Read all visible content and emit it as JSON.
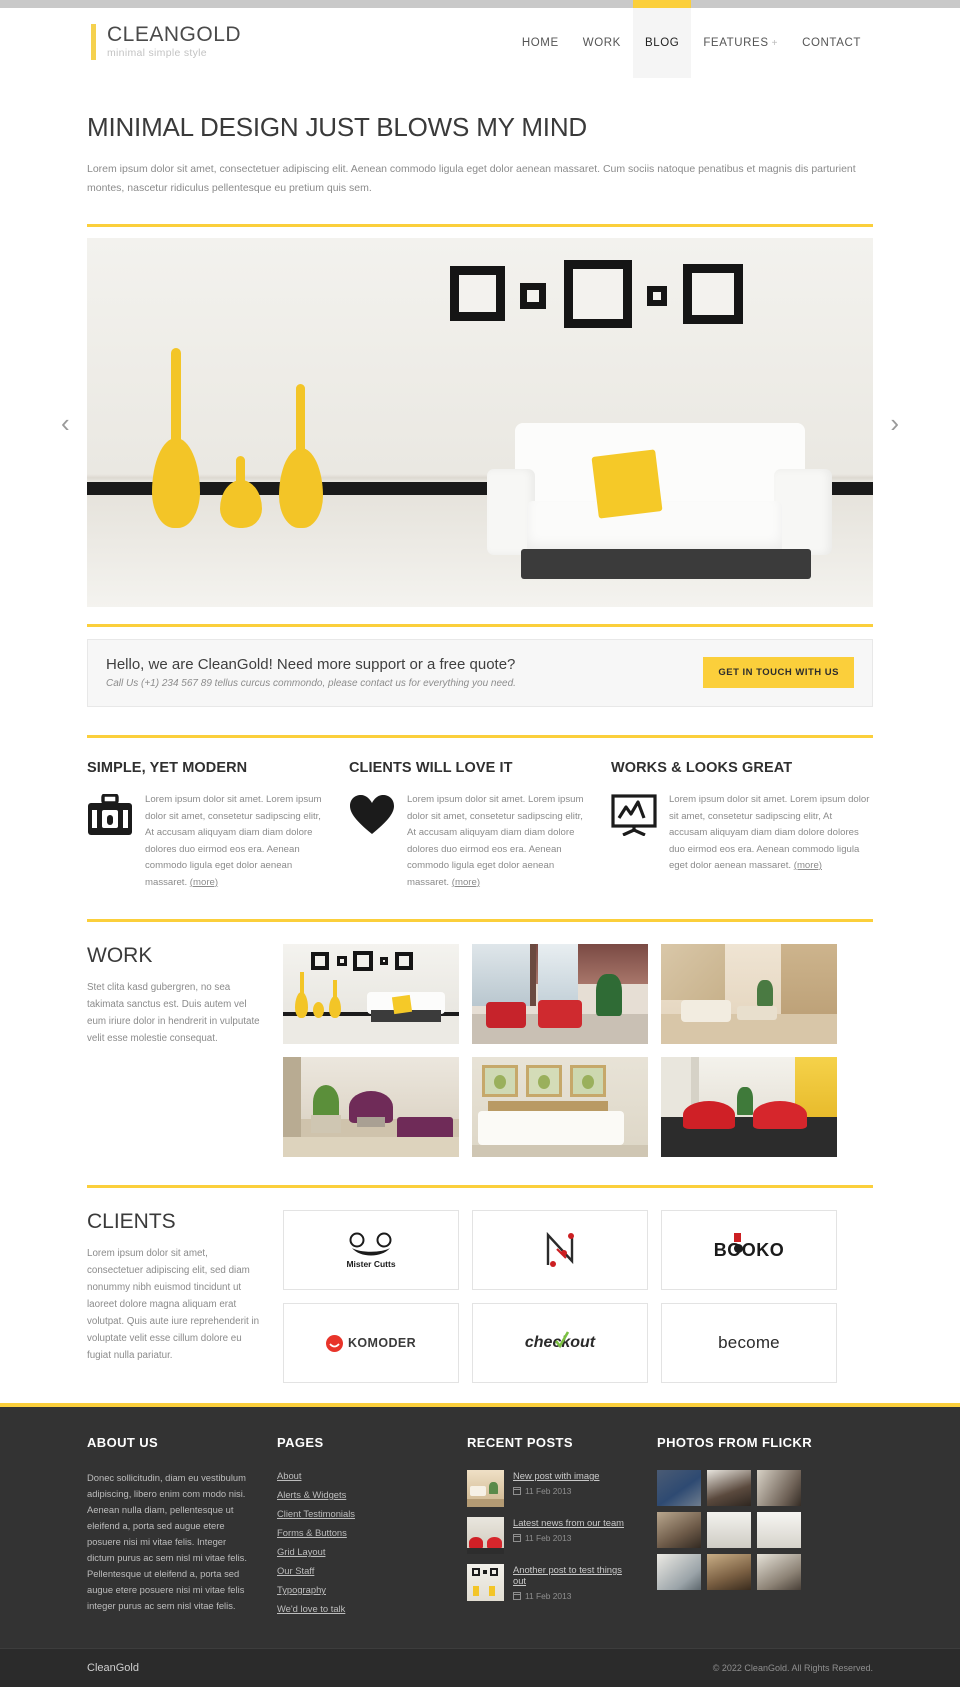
{
  "brand": {
    "name": "CLEANGOLD",
    "tagline": "minimal simple style"
  },
  "nav": {
    "items": [
      {
        "label": "HOME",
        "active": false
      },
      {
        "label": "WORK",
        "active": false
      },
      {
        "label": "BLOG",
        "active": true
      },
      {
        "label": "FEATURES",
        "active": false,
        "suffix": "+"
      },
      {
        "label": "CONTACT",
        "active": false
      }
    ]
  },
  "hero": {
    "title": "MINIMAL DESIGN JUST BLOWS MY MIND",
    "intro": "Lorem ipsum dolor sit amet, consectetuer adipiscing elit. Aenean commodo ligula eget dolor aenean massaret. Cum sociis natoque penatibus et magnis dis parturient montes, nascetur ridiculus pellentesque eu pretium quis sem.",
    "prev_arrow": "‹",
    "next_arrow": "›"
  },
  "cta": {
    "heading": "Hello, we are CleanGold! Need more support or a free quote?",
    "subtext": "Call Us (+1) 234 567 89 tellus curcus commondo, please contact us for everything you need.",
    "button": "GET IN TOUCH WITH US"
  },
  "features": [
    {
      "title": "SIMPLE, YET MODERN",
      "icon": "lock-briefcase-icon",
      "body": "Lorem ipsum dolor sit amet. Lorem ipsum dolor sit amet, consetetur sadipscing elitr, At accusam aliquyam diam diam dolore dolores duo eirmod eos era. Aenean commodo ligula eget dolor aenean massaret.",
      "more": "(more)"
    },
    {
      "title": "CLIENTS WILL LOVE IT",
      "icon": "heart-icon",
      "body": "Lorem ipsum dolor sit amet. Lorem ipsum dolor sit amet, consetetur sadipscing elitr, At accusam aliquyam diam diam dolore dolores duo eirmod eos era. Aenean commodo ligula eget dolor aenean massaret.",
      "more": "(more)"
    },
    {
      "title": "WORKS & LOOKS GREAT",
      "icon": "chart-presentation-icon",
      "body": "Lorem ipsum dolor sit amet. Lorem ipsum dolor sit amet, consetetur sadipscing elitr, At accusam aliquyam diam diam dolore dolores duo eirmod eos era. Aenean commodo ligula eget dolor aenean massaret.",
      "more": "(more)"
    }
  ],
  "work": {
    "title": "WORK",
    "text": "Stet clita kasd gubergren, no sea takimata sanctus est. Duis autem vel eum iriure dolor in hendrerit in vulputate velit esse molestie consequat.",
    "items": [
      {
        "name": "white-sofa-yellow-vases"
      },
      {
        "name": "red-armchairs-lounge"
      },
      {
        "name": "attic-living-room"
      },
      {
        "name": "purple-chairs-room"
      },
      {
        "name": "bedroom-with-art"
      },
      {
        "name": "red-modern-chairs"
      }
    ]
  },
  "clients": {
    "title": "CLIENTS",
    "text": "Lorem ipsum dolor sit amet, consectetuer adipiscing elit, sed diam nonummy nibh euismod tincidunt ut laoreet dolore magna aliquam erat volutpat. Quis aute iure reprehenderit in voluptate velit esse cillum dolore eu fugiat nulla pariatur.",
    "logos": [
      {
        "name": "Mister Cutts",
        "type": "mister-cutts"
      },
      {
        "name": "N",
        "type": "n-mark"
      },
      {
        "name": "BOOKO",
        "type": "booko"
      },
      {
        "name": "KOMODER",
        "type": "komoder"
      },
      {
        "name": "checkout",
        "type": "checkout"
      },
      {
        "name": "become",
        "type": "become"
      }
    ]
  },
  "footer": {
    "about": {
      "title": "ABOUT US",
      "text": "Donec sollicitudin, diam eu vestibulum adipiscing, libero enim com modo nisi. Aenean nulla diam, pellentesque ut eleifend a, porta sed augue etere posuere nisi mi vitae felis. Integer dictum purus ac sem nisl mi vitae felis. Pellentesque ut eleifend a, porta sed augue etere posuere nisi mi vitae felis integer purus ac sem nisl vitae felis."
    },
    "pages": {
      "title": "PAGES",
      "links": [
        "About",
        "Alerts & Widgets",
        "Client Testimonials",
        "Forms & Buttons",
        "Grid Layout",
        "Our Staff",
        "Typography",
        "We'd love to talk"
      ]
    },
    "recent_posts": {
      "title": "RECENT POSTS",
      "items": [
        {
          "title": "New post with image",
          "date": "11 Feb 2013",
          "thumb": "attic-room-thumb"
        },
        {
          "title": "Latest news from our team",
          "date": "11 Feb 2013",
          "thumb": "red-chairs-thumb"
        },
        {
          "title": "Another post to test things out",
          "date": "11 Feb 2013",
          "thumb": "frames-lamp-thumb"
        }
      ]
    },
    "flickr": {
      "title": "PHOTOS FROM FLICKR",
      "photos": [
        {
          "name": "blue-bed-photo"
        },
        {
          "name": "dark-hall-photo"
        },
        {
          "name": "corridor-photo"
        },
        {
          "name": "doorway-photo"
        },
        {
          "name": "white-wall-photo"
        },
        {
          "name": "white-room-photo"
        },
        {
          "name": "bathroom-photo"
        },
        {
          "name": "closet-photo"
        },
        {
          "name": "wardrobe-photo"
        }
      ]
    },
    "bottom": {
      "brand": "CleanGold",
      "copyright": "© 2022 CleanGold. All Rights Reserved."
    }
  },
  "colors": {
    "accent": "#fbcf3b",
    "dark": "#333333",
    "text": "#8b8b8b"
  }
}
